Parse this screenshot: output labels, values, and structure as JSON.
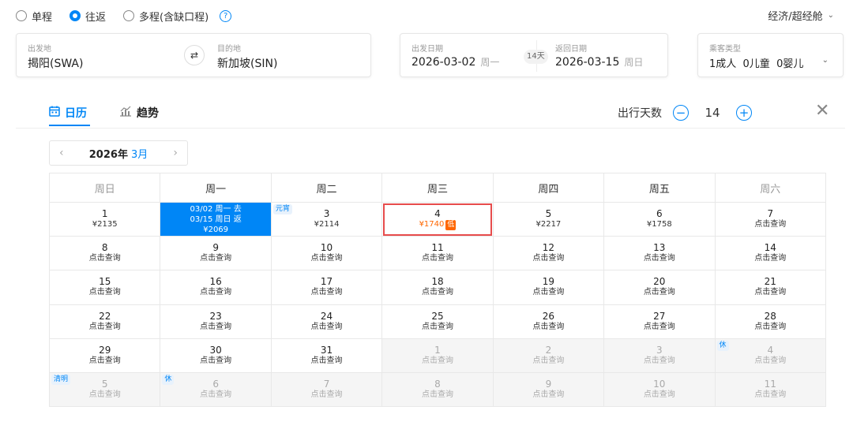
{
  "trip_types": [
    {
      "label": "单程",
      "checked": false
    },
    {
      "label": "往返",
      "checked": true
    },
    {
      "label": "多程(含缺口程)",
      "checked": false
    }
  ],
  "help_icon": "?",
  "cabin": "经济/超经舱",
  "origin": {
    "label": "出发地",
    "value": "揭阳(SWA)"
  },
  "destination": {
    "label": "目的地",
    "value": "新加坡(SIN)"
  },
  "depart": {
    "label": "出发日期",
    "date": "2026-03-02",
    "weekday": "周一"
  },
  "return": {
    "label": "返回日期",
    "date": "2026-03-15",
    "weekday": "周日"
  },
  "trip_days_badge": "14天",
  "passengers": {
    "label": "乘客类型",
    "value": "1成人  0儿童  0婴儿"
  },
  "tabs": [
    {
      "label": "日历",
      "icon": "calendar-icon",
      "active": true
    },
    {
      "label": "趋势",
      "icon": "trend-chart-icon",
      "active": false
    }
  ],
  "travel_days": {
    "label": "出行天数",
    "value": "14",
    "minus": "−",
    "plus": "+"
  },
  "month_nav": {
    "year": "2026年",
    "month": "3月",
    "prev": "‹",
    "next": "›"
  },
  "weekdays": [
    "周日",
    "周一",
    "周二",
    "周三",
    "周四",
    "周五",
    "周六"
  ],
  "rows": [
    [
      {
        "day": "1",
        "text": "¥2135"
      },
      {
        "day": "",
        "text": "03/02 周一 去",
        "text2": "03/15 周日 返",
        "text3": "¥2069",
        "state": "selected"
      },
      {
        "day": "3",
        "text": "¥2114",
        "tag": "元宵"
      },
      {
        "day": "4",
        "text": "¥1740",
        "badge": "低",
        "state": "lowest"
      },
      {
        "day": "5",
        "text": "¥2217"
      },
      {
        "day": "6",
        "text": "¥1758"
      },
      {
        "day": "7",
        "text": "点击查询"
      }
    ],
    [
      {
        "day": "8",
        "text": "点击查询"
      },
      {
        "day": "9",
        "text": "点击查询"
      },
      {
        "day": "10",
        "text": "点击查询"
      },
      {
        "day": "11",
        "text": "点击查询"
      },
      {
        "day": "12",
        "text": "点击查询"
      },
      {
        "day": "13",
        "text": "点击查询"
      },
      {
        "day": "14",
        "text": "点击查询"
      }
    ],
    [
      {
        "day": "15",
        "text": "点击查询"
      },
      {
        "day": "16",
        "text": "点击查询"
      },
      {
        "day": "17",
        "text": "点击查询"
      },
      {
        "day": "18",
        "text": "点击查询"
      },
      {
        "day": "19",
        "text": "点击查询"
      },
      {
        "day": "20",
        "text": "点击查询"
      },
      {
        "day": "21",
        "text": "点击查询"
      }
    ],
    [
      {
        "day": "22",
        "text": "点击查询"
      },
      {
        "day": "23",
        "text": "点击查询"
      },
      {
        "day": "24",
        "text": "点击查询"
      },
      {
        "day": "25",
        "text": "点击查询"
      },
      {
        "day": "26",
        "text": "点击查询"
      },
      {
        "day": "27",
        "text": "点击查询"
      },
      {
        "day": "28",
        "text": "点击查询"
      }
    ],
    [
      {
        "day": "29",
        "text": "点击查询"
      },
      {
        "day": "30",
        "text": "点击查询"
      },
      {
        "day": "31",
        "text": "点击查询"
      },
      {
        "day": "1",
        "text": "点击查询",
        "state": "grey"
      },
      {
        "day": "2",
        "text": "点击查询",
        "state": "grey"
      },
      {
        "day": "3",
        "text": "点击查询",
        "state": "grey"
      },
      {
        "day": "4",
        "text": "点击查询",
        "state": "grey",
        "tag": "休"
      }
    ],
    [
      {
        "day": "5",
        "text": "点击查询",
        "state": "grey",
        "tag": "清明"
      },
      {
        "day": "6",
        "text": "点击查询",
        "state": "grey",
        "tag": "休"
      },
      {
        "day": "7",
        "text": "点击查询",
        "state": "grey"
      },
      {
        "day": "8",
        "text": "点击查询",
        "state": "grey"
      },
      {
        "day": "9",
        "text": "点击查询",
        "state": "grey"
      },
      {
        "day": "10",
        "text": "点击查询",
        "state": "grey"
      },
      {
        "day": "11",
        "text": "点击查询",
        "state": "grey"
      }
    ]
  ]
}
